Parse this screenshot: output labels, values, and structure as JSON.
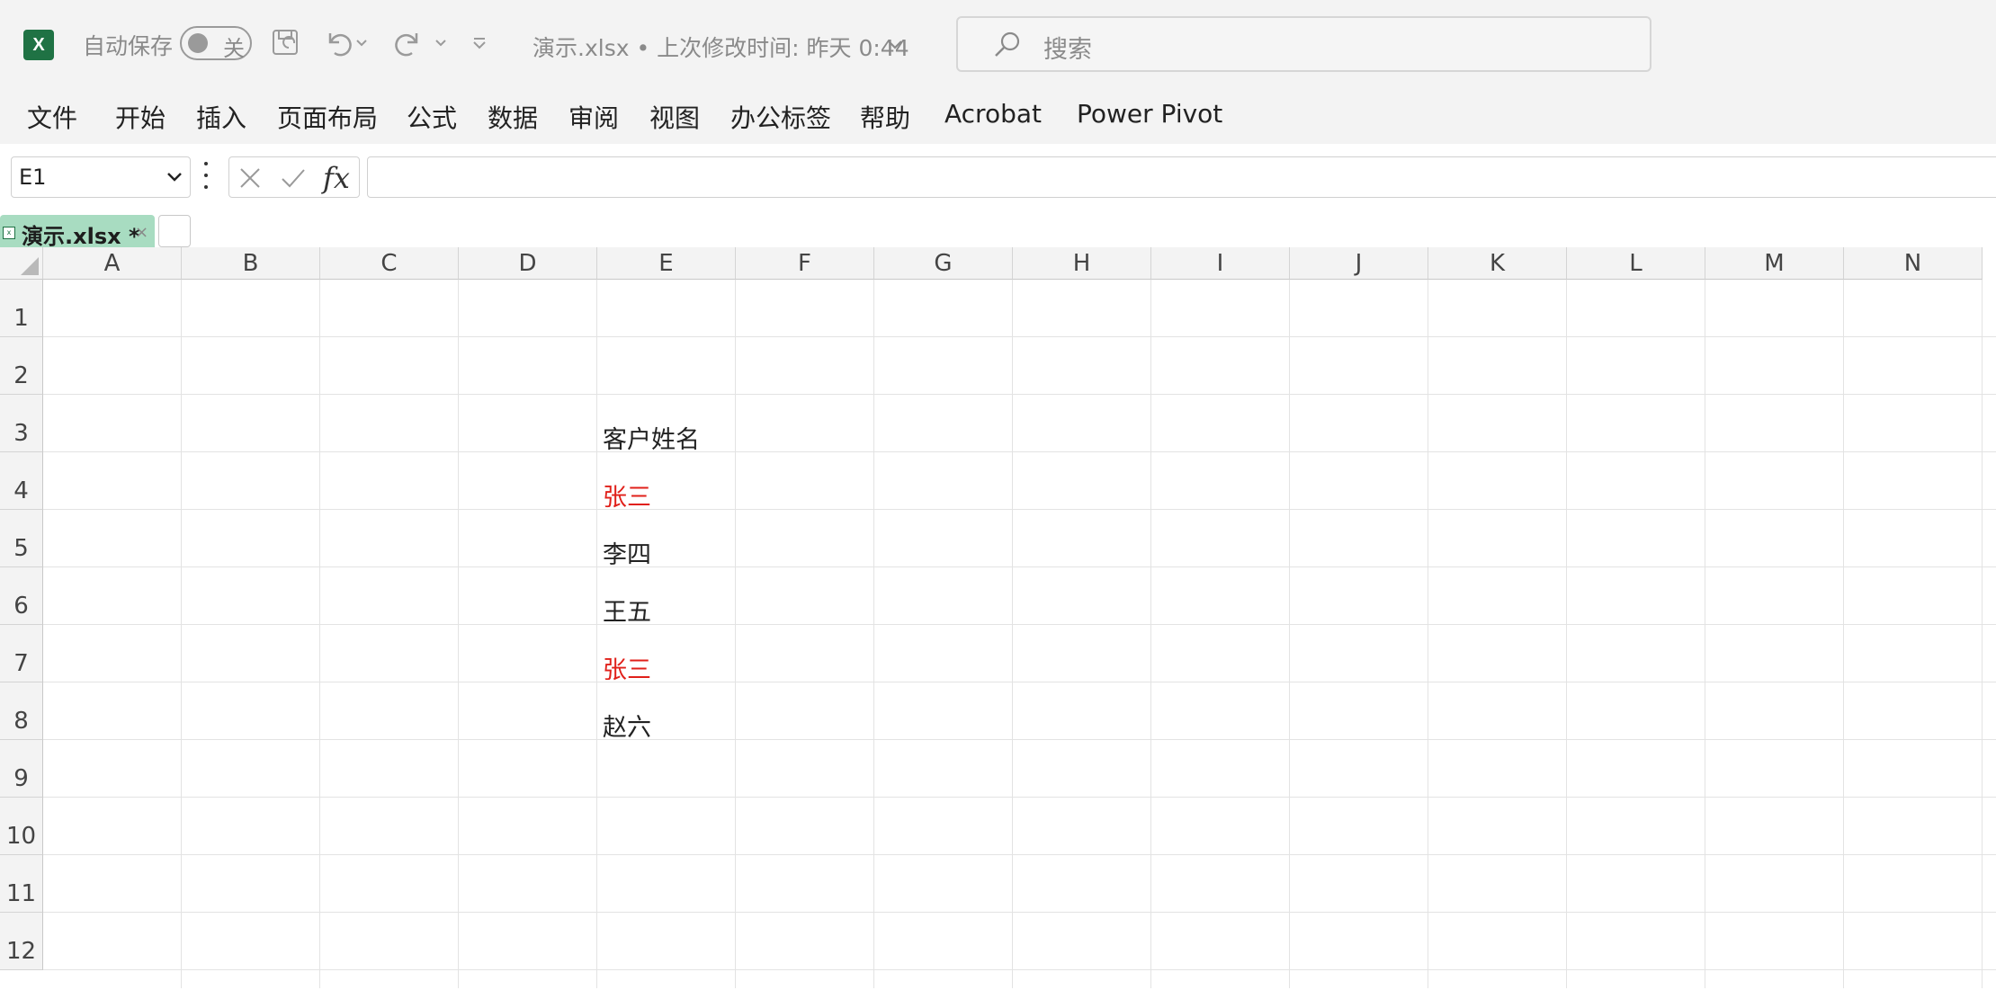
{
  "titlebar": {
    "app_icon_letter": "X",
    "autosave_label": "自动保存",
    "autosave_state": "关",
    "doc_title": "演示.xlsx • 上次修改时间: 昨天 0:44",
    "search_placeholder": "搜索"
  },
  "ribbon": {
    "tabs": [
      "文件",
      "开始",
      "插入",
      "页面布局",
      "公式",
      "数据",
      "审阅",
      "视图",
      "办公标签",
      "帮助",
      "Acrobat",
      "Power Pivot"
    ]
  },
  "formula_bar": {
    "name_box": "E1",
    "fx_label": "fx",
    "formula_value": ""
  },
  "workbook_tabs": {
    "active_label": "演示.xlsx *",
    "close_glyph": "×"
  },
  "sheet": {
    "columns": [
      "A",
      "B",
      "C",
      "D",
      "E",
      "F",
      "G",
      "H",
      "I",
      "J",
      "K",
      "L",
      "M",
      "N"
    ],
    "rows": [
      "1",
      "2",
      "3",
      "4",
      "5",
      "6",
      "7",
      "8",
      "9",
      "10",
      "11",
      "12"
    ],
    "cells": {
      "E3": {
        "text": "客户姓名",
        "color": "#222222"
      },
      "E4": {
        "text": "张三",
        "color": "#e0201a"
      },
      "E5": {
        "text": "李四",
        "color": "#222222"
      },
      "E6": {
        "text": "王五",
        "color": "#222222"
      },
      "E7": {
        "text": "张三",
        "color": "#e0201a"
      },
      "E8": {
        "text": "赵六",
        "color": "#222222"
      }
    }
  },
  "colors": {
    "excel_green": "#1f7244",
    "workbook_tab": "#a8dcc1",
    "duplicate_highlight": "#e0201a"
  }
}
